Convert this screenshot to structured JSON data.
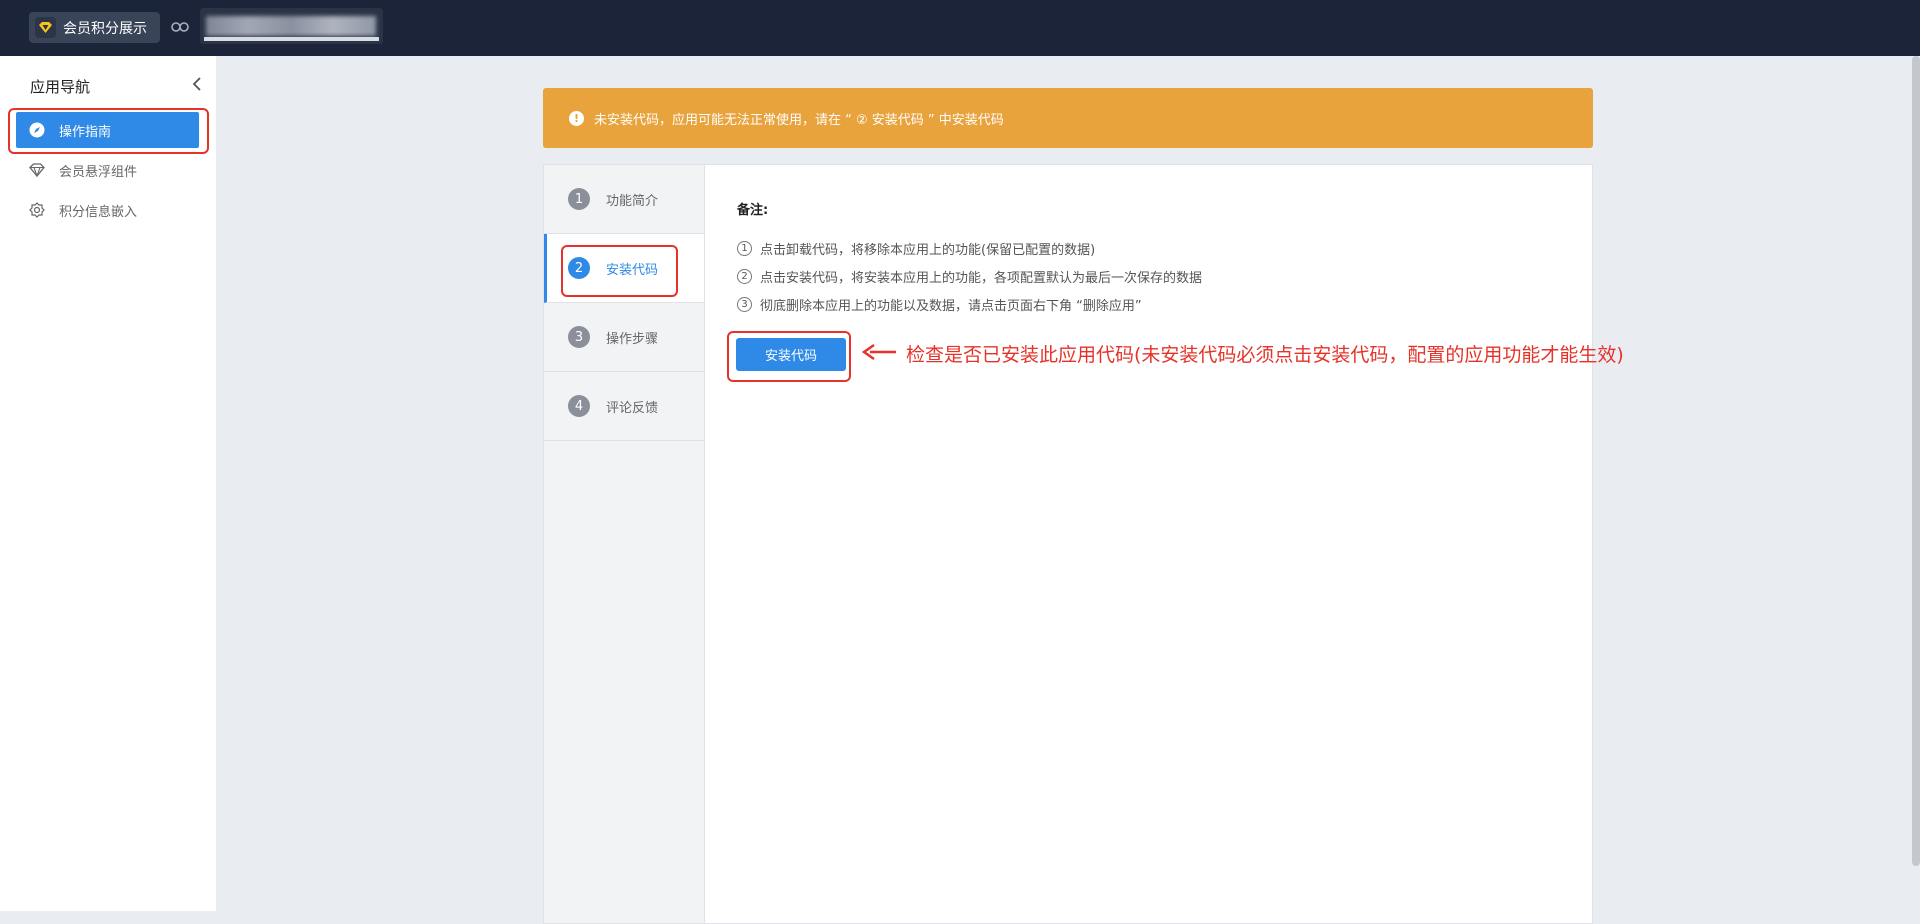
{
  "topbar": {
    "app_name": "会员积分展示",
    "app_logo_icon": "diamond-icon",
    "link_icon": "link-icon"
  },
  "sidebar": {
    "title": "应用导航",
    "items": [
      {
        "label": "操作指南",
        "icon": "compass-icon",
        "active": true
      },
      {
        "label": "会员悬浮组件",
        "icon": "diamond-icon",
        "active": false
      },
      {
        "label": "积分信息嵌入",
        "icon": "badge-icon",
        "active": false
      }
    ]
  },
  "warning": {
    "text": "未安装代码，应用可能无法正常使用，请在 “ ② 安装代码 ” 中安装代码"
  },
  "steps": [
    {
      "num": "1",
      "label": "功能简介",
      "active": false
    },
    {
      "num": "2",
      "label": "安装代码",
      "active": true
    },
    {
      "num": "3",
      "label": "操作步骤",
      "active": false
    },
    {
      "num": "4",
      "label": "评论反馈",
      "active": false
    }
  ],
  "notes": {
    "title": "备注:",
    "items": [
      {
        "num": "1",
        "text": "点击卸载代码，将移除本应用上的功能(保留已配置的数据)"
      },
      {
        "num": "2",
        "text": "点击安装代码，将安装本应用上的功能，各项配置默认为最后一次保存的数据"
      },
      {
        "num": "3",
        "text": "彻底删除本应用上的功能以及数据，请点击页面右下角 “删除应用”"
      }
    ]
  },
  "install_button": {
    "label": "安装代码"
  },
  "callout": {
    "text": "检查是否已安装此应用代码(未安装代码必须点击安装代码，配置的应用功能才能生效)"
  },
  "colors": {
    "topbar": "#1b2438",
    "accent": "#2e8ae6",
    "warning": "#e8a33d",
    "annotation": "#e5332a"
  }
}
